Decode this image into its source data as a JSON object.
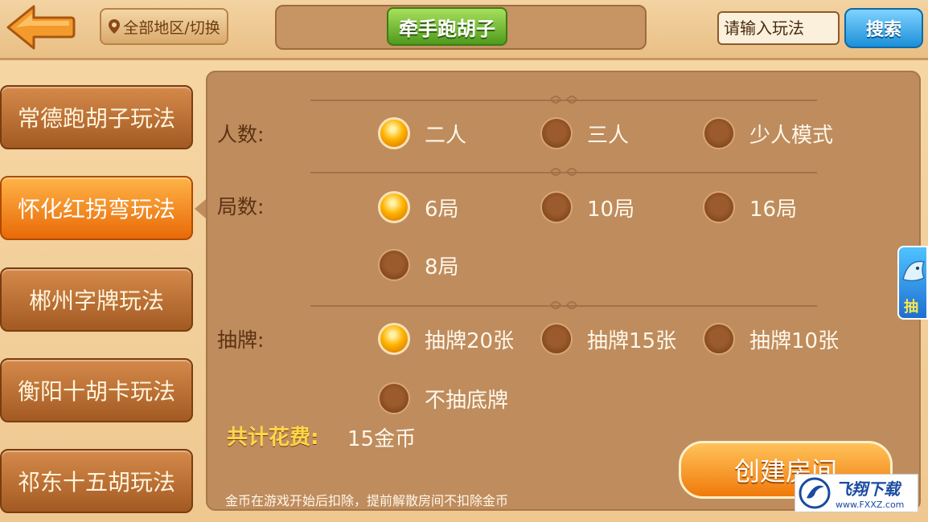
{
  "header": {
    "region_label": "全部地区/切换",
    "title": "牵手跑胡子",
    "search_placeholder": "请输入玩法",
    "search_button": "搜索"
  },
  "sidebar": {
    "items": [
      {
        "label": "常德跑胡子玩法",
        "active": false
      },
      {
        "label": "怀化红拐弯玩法",
        "active": true
      },
      {
        "label": "郴州字牌玩法",
        "active": false
      },
      {
        "label": "衡阳十胡卡玩法",
        "active": false
      },
      {
        "label": "祁东十五胡玩法",
        "active": false
      }
    ]
  },
  "options": {
    "players": {
      "label": "人数:",
      "choices": [
        "二人",
        "三人",
        "少人模式"
      ],
      "selected": "二人"
    },
    "rounds": {
      "label": "局数:",
      "choices": [
        "6局",
        "10局",
        "16局",
        "8局"
      ],
      "selected": "6局"
    },
    "draw": {
      "label": "抽牌:",
      "choices": [
        "抽牌20张",
        "抽牌15张",
        "抽牌10张",
        "不抽底牌"
      ],
      "selected": "抽牌20张"
    }
  },
  "cost": {
    "label": "共计花费:",
    "value": "15金币"
  },
  "notice": "金币在游戏开始后扣除，提前解散房间不扣除金币",
  "create_button": "创建房间",
  "promo": {
    "label": "抽"
  },
  "watermark": {
    "main": "飞翔下载",
    "url": "www.FXXZ.com"
  },
  "colors": {
    "accent_orange": "#f07a0a",
    "panel_brown": "#bf8c5e",
    "title_green": "#4f9a1d",
    "search_blue": "#1c8fd8"
  }
}
